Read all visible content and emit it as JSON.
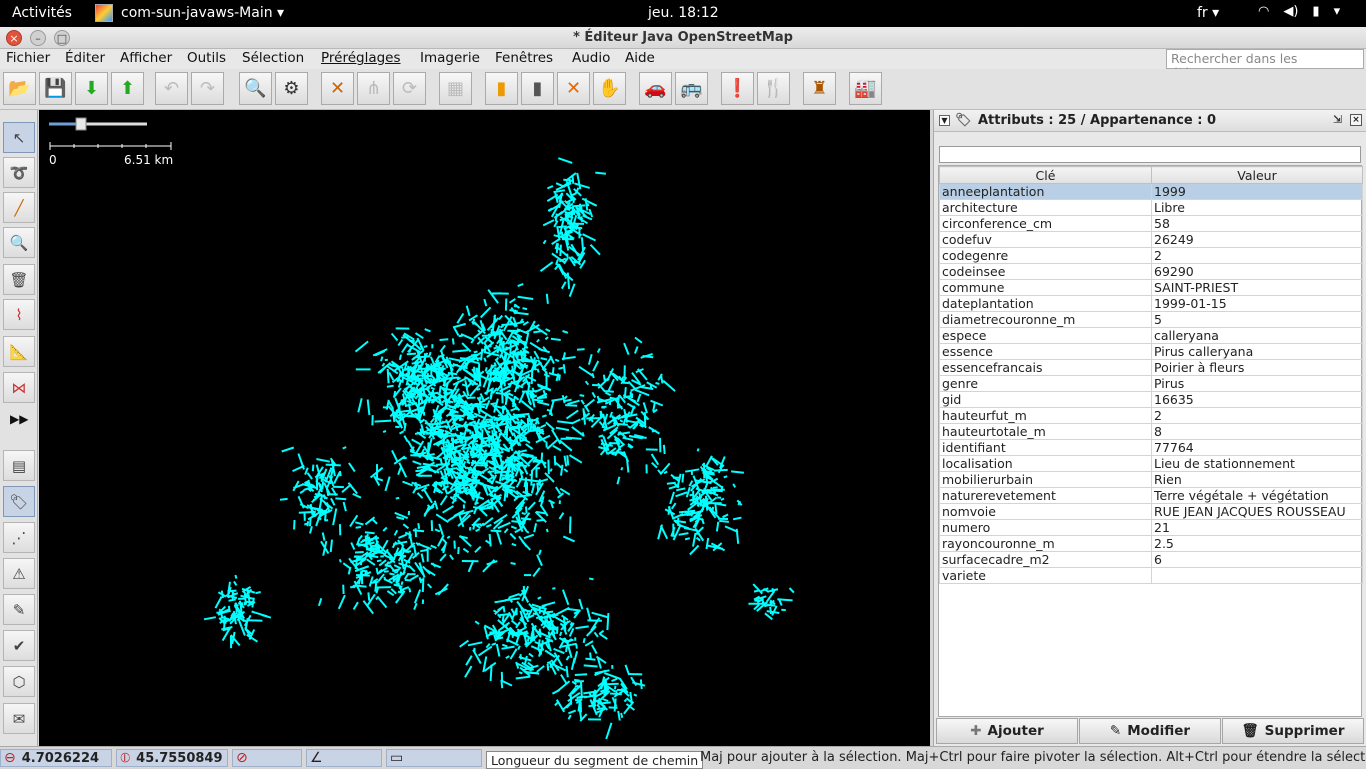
{
  "topbar": {
    "activities": "Activités",
    "app_name": "com-sun-javaws-Main ▾",
    "clock": "jeu. 18:12",
    "lang": "fr ▾"
  },
  "window": {
    "title": "* Éditeur Java OpenStreetMap"
  },
  "menu": {
    "items": [
      "Fichier",
      "Éditer",
      "Afficher",
      "Outils",
      "Sélection",
      "Préréglages",
      "Imagerie",
      "Fenêtres",
      "Audio",
      "Aide"
    ],
    "search_placeholder": "Rechercher dans les éléments"
  },
  "map": {
    "scale_zero": "0",
    "scale_distance": "6.51 km",
    "feature_color": "#00ffff",
    "background": "#000000"
  },
  "panel": {
    "title": "Attributs : 25 / Appartenance : 0",
    "col_key": "Clé",
    "col_value": "Valeur",
    "rows": [
      {
        "k": "anneeplantation",
        "v": "1999"
      },
      {
        "k": "architecture",
        "v": "Libre"
      },
      {
        "k": "circonference_cm",
        "v": "58"
      },
      {
        "k": "codefuv",
        "v": "26249"
      },
      {
        "k": "codegenre",
        "v": "2"
      },
      {
        "k": "codeinsee",
        "v": "69290"
      },
      {
        "k": "commune",
        "v": "SAINT-PRIEST"
      },
      {
        "k": "dateplantation",
        "v": "1999-01-15"
      },
      {
        "k": "diametrecouronne_m",
        "v": "5"
      },
      {
        "k": "espece",
        "v": "calleryana"
      },
      {
        "k": "essence",
        "v": "Pirus calleryana"
      },
      {
        "k": "essencefrancais",
        "v": "Poirier à fleurs"
      },
      {
        "k": "genre",
        "v": "Pirus"
      },
      {
        "k": "gid",
        "v": "16635"
      },
      {
        "k": "hauteurfut_m",
        "v": "2"
      },
      {
        "k": "hauteurtotale_m",
        "v": "8"
      },
      {
        "k": "identifiant",
        "v": "77764"
      },
      {
        "k": "localisation",
        "v": "Lieu de stationnement"
      },
      {
        "k": "mobilierurbain",
        "v": "Rien"
      },
      {
        "k": "naturerevetement",
        "v": "Terre végétale + végétation"
      },
      {
        "k": "nomvoie",
        "v": "RUE JEAN JACQUES ROUSSEAU"
      },
      {
        "k": "numero",
        "v": "21"
      },
      {
        "k": "rayoncouronne_m",
        "v": "2.5"
      },
      {
        "k": "surfacecadre_m2",
        "v": "6"
      },
      {
        "k": "variete",
        "v": ""
      }
    ],
    "btn_add": "Ajouter",
    "btn_edit": "Modifier",
    "btn_delete": "Supprimer"
  },
  "status": {
    "lon": "4.7026224",
    "lat": "45.7550849",
    "tooltip": "Longueur du segment de chemin",
    "hint": "Maj pour ajouter à la sélection. Maj+Ctrl pour faire pivoter la sélection. Alt+Ctrl pour étendre la sélection."
  }
}
